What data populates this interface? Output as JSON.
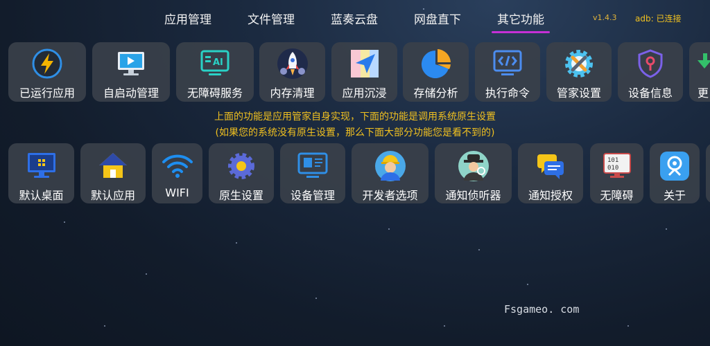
{
  "nav": {
    "tabs": [
      {
        "label": "应用管理"
      },
      {
        "label": "文件管理"
      },
      {
        "label": "蓝奏云盘"
      },
      {
        "label": "网盘直下"
      },
      {
        "label": "其它功能"
      }
    ],
    "active_tab": "其它功能",
    "version": "v1.4.3",
    "adb_status": "adb: 已连接"
  },
  "row1": [
    {
      "label": "已运行应用",
      "icon": "lightning-icon"
    },
    {
      "label": "自启动管理",
      "icon": "monitor-play-icon"
    },
    {
      "label": "无障碍服务",
      "icon": "ai-screen-icon"
    },
    {
      "label": "内存清理",
      "icon": "rocket-icon"
    },
    {
      "label": "应用沉浸",
      "icon": "map-arrow-icon"
    },
    {
      "label": "存储分析",
      "icon": "pie-chart-icon"
    },
    {
      "label": "执行命令",
      "icon": "code-monitor-icon"
    },
    {
      "label": "管家设置",
      "icon": "gear-wrench-icon"
    },
    {
      "label": "设备信息",
      "icon": "shield-key-icon"
    },
    {
      "label": "更",
      "icon": "download-arrow-icon"
    }
  ],
  "notice": {
    "line1": "上面的功能是应用管家自身实现，下面的功能是调用系统原生设置",
    "line2": "(如果您的系统没有原生设置，那么下面大部分功能您是看不到的)"
  },
  "row2": [
    {
      "label": "默认桌面",
      "icon": "desktop-icon"
    },
    {
      "label": "默认应用",
      "icon": "home-icon"
    },
    {
      "label": "WIFI",
      "icon": "wifi-icon"
    },
    {
      "label": "原生设置",
      "icon": "gear-icon"
    },
    {
      "label": "设备管理",
      "icon": "device-manage-icon"
    },
    {
      "label": "开发者选项",
      "icon": "worker-avatar-icon"
    },
    {
      "label": "通知侦听器",
      "icon": "detective-avatar-icon"
    },
    {
      "label": "通知授权",
      "icon": "chat-bubbles-icon"
    },
    {
      "label": "无障碍",
      "icon": "binary-screen-icon"
    },
    {
      "label": "关于",
      "icon": "info-badge-icon"
    }
  ],
  "watermark": "Fsgameo. com",
  "colors": {
    "tab_underline": "#c630d6",
    "notice_text": "#f0c020",
    "tile_bg": "#3a404a"
  }
}
